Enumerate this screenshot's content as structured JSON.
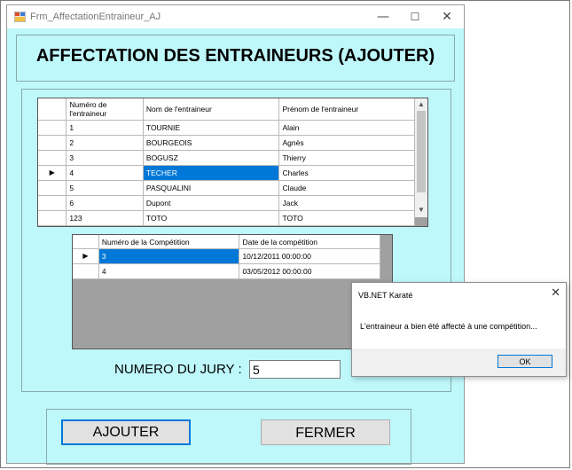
{
  "window": {
    "title": "Frm_AffectationEntraineur_AJ",
    "min_glyph": "—",
    "max_glyph": "☐",
    "close_glyph": "✕"
  },
  "header": {
    "title": "AFFECTATION DES ENTRAINEURS (AJOUTER)"
  },
  "trainers_grid": {
    "col_numero": "Numéro de l'entraineur",
    "col_nom": "Nom de l'entraineur",
    "col_prenom": "Prénom de l'entraineur",
    "rows": [
      {
        "numero": "1",
        "nom": "TOURNIE",
        "prenom": "Alain"
      },
      {
        "numero": "2",
        "nom": "BOURGEOIS",
        "prenom": "Agnès"
      },
      {
        "numero": "3",
        "nom": "BOGUSZ",
        "prenom": "Thierry"
      },
      {
        "numero": "4",
        "nom": "TECHER",
        "prenom": "Charles"
      },
      {
        "numero": "5",
        "nom": "PASQUALINI",
        "prenom": "Claude"
      },
      {
        "numero": "6",
        "nom": "Dupont",
        "prenom": "Jack"
      },
      {
        "numero": "123",
        "nom": "TOTO",
        "prenom": "TOTO"
      }
    ],
    "current_marker": "▶",
    "scroll_up": "▲",
    "scroll_down": "▼"
  },
  "competitions_grid": {
    "col_numero": "Numéro de la Compétition",
    "col_date": "Date de la compétition",
    "rows": [
      {
        "numero": "3",
        "date": "10/12/2011 00:00:00"
      },
      {
        "numero": "4",
        "date": "03/05/2012 00:00:00"
      }
    ],
    "current_marker": "▶"
  },
  "jury": {
    "label": "NUMERO DU JURY :",
    "value": "5"
  },
  "buttons": {
    "ajouter": "AJOUTER",
    "fermer": "FERMER"
  },
  "messagebox": {
    "title": "VB.NET Karaté",
    "close_glyph": "✕",
    "message": "L'entraineur a bien été affecté à une compétition...",
    "ok": "OK"
  },
  "colors": {
    "form_bg": "#bff8fb",
    "selection": "#0078d7",
    "grid_bg": "#a0a0a0"
  }
}
